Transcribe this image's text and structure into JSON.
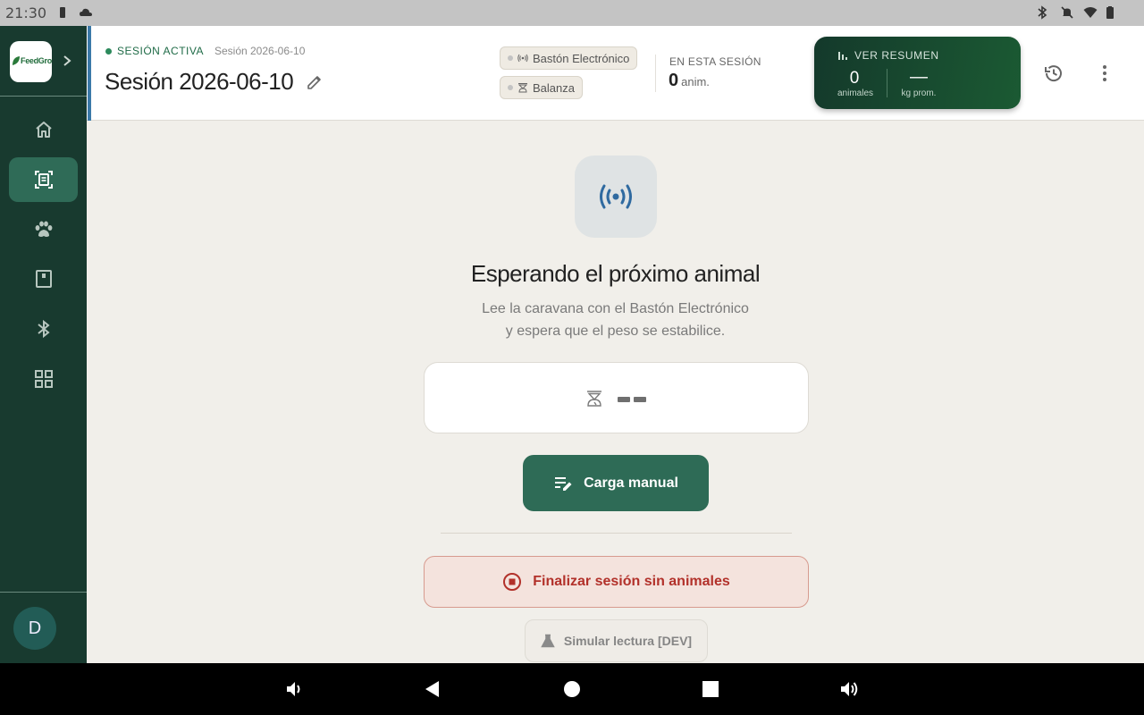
{
  "status_bar": {
    "time": "21:30"
  },
  "sidebar": {
    "logo_text": "FeedGro",
    "nav_items": [
      {
        "name": "home",
        "icon": "home-icon",
        "active": false
      },
      {
        "name": "session-scan",
        "icon": "scan-document-icon",
        "active": true
      },
      {
        "name": "animals",
        "icon": "paw-icon",
        "active": false
      },
      {
        "name": "reports",
        "icon": "clipboard-icon",
        "active": false
      },
      {
        "name": "bluetooth",
        "icon": "bluetooth-icon",
        "active": false
      },
      {
        "name": "apps",
        "icon": "grid-icon",
        "active": false
      }
    ],
    "avatar_initial": "D"
  },
  "header": {
    "status_label": "SESIÓN ACTIVA",
    "session_subtitle": "Sesión 2026-06-10",
    "title": "Sesión 2026-06-10",
    "devices": [
      {
        "label": "Bastón Electrónico",
        "icon": "rfid-icon"
      },
      {
        "label": "Balanza",
        "icon": "scale-icon"
      }
    ],
    "in_session_label": "EN ESTA SESIÓN",
    "in_session_count": "0",
    "in_session_unit": "anim.",
    "summary": {
      "title": "VER RESUMEN",
      "animals_value": "0",
      "animals_label": "animales",
      "avg_value": "—",
      "avg_label": "kg prom."
    }
  },
  "main": {
    "waiting_title": "Esperando el próximo animal",
    "waiting_line1": "Lee la caravana con el Bastón Electrónico",
    "waiting_line2": "y espera que el peso se estabilice.",
    "manual_button": "Carga manual",
    "finish_button": "Finalizar sesión sin animales",
    "dev_button": "Simular lectura [DEV]"
  },
  "colors": {
    "sidebar_bg": "#183a2f",
    "accent_green": "#2e6b56",
    "danger": "#b2312a",
    "info_blue": "#2f6aa0"
  }
}
